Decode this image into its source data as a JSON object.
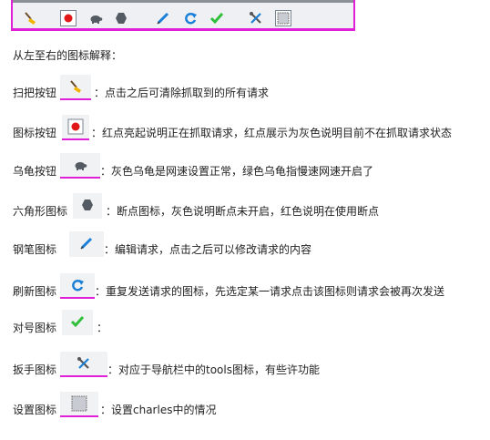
{
  "heading": "从左至右的图标解释：",
  "rows": [
    {
      "label": "扫把按钮",
      "desc": "：点击之后可清除抓取到的所有请求",
      "icon": "broom-icon"
    },
    {
      "label": "图标按钮",
      "desc": "：红点亮起说明正在抓取请求，红点展示为灰色说明目前不在抓取请求状态",
      "icon": "record-icon"
    },
    {
      "label": "乌龟按钮",
      "desc": "：灰色乌龟是网速设置正常，绿色乌龟指慢速网速开启了",
      "icon": "turtle-icon"
    },
    {
      "label": "六角形图标",
      "desc": "：断点图标，灰色说明断点未开启，红色说明在使用断点",
      "icon": "hexagon-icon"
    },
    {
      "label": "钢笔图标",
      "desc": "：编辑请求，点击之后可以修改请求的内容",
      "icon": "pen-icon"
    },
    {
      "label": "刷新图标",
      "desc": "：重复发送请求的图标，先选定某一请求点击该图标则请求会被再次发送",
      "icon": "refresh-icon"
    },
    {
      "label": "对号图标",
      "desc": "：",
      "icon": "check-icon"
    },
    {
      "label": "扳手图标",
      "desc": "：对应于导航栏中的tools图标，有些许功能",
      "icon": "tools-icon"
    },
    {
      "label": "设置图标",
      "desc": "：设置charles中的情况",
      "icon": "settings-icon"
    }
  ],
  "colors": {
    "accent": "#e020d8",
    "record": "#e01818",
    "refresh": "#1a7fd6",
    "check": "#2fbf3a"
  }
}
